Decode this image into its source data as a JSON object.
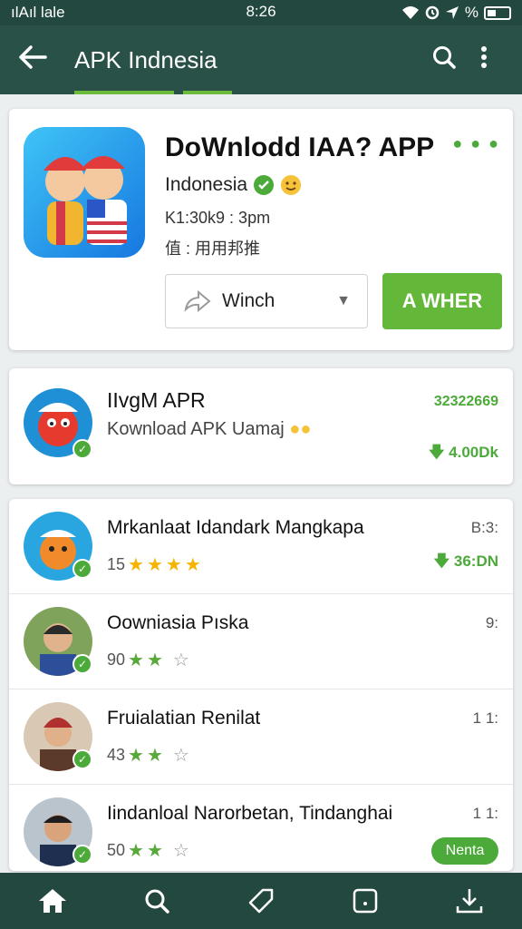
{
  "status_bar": {
    "carrier": "ılAıl lale",
    "time": "8:26",
    "battery": "%"
  },
  "app_bar": {
    "title": "APK Indnesia"
  },
  "hero": {
    "title": "DoWnlodd IAA? APP",
    "subtitle": "Indonesia",
    "meta": "K1:30k9 : 3pm",
    "meta2": "值 : 用用邦推",
    "secondary_button": "Winch",
    "primary_button": "A WHER"
  },
  "featured": {
    "title": "IIvgM APR",
    "subtitle": "Kownload APK Uamaj",
    "count": "32322669",
    "downloads": "4.00Dk"
  },
  "list": [
    {
      "title": "Mrkanlaat Idandark Mangkapa",
      "rating": "15",
      "stars": 4,
      "right": "B:3:",
      "right2": "36:DN"
    },
    {
      "title": "Oowniasia Pıska",
      "rating": "90",
      "stars": 2,
      "right": "9:"
    },
    {
      "title": "Fruialatian Renilat",
      "rating": "43",
      "stars": 2,
      "right": "1 1:"
    },
    {
      "title": "Iindanloal Narorbetan, Tindanghai",
      "rating": "50",
      "stars": 2,
      "right": "1 1:",
      "pill": "Nenta"
    }
  ],
  "colors": {
    "app_bar": "#2a5148",
    "accent": "#63b83a",
    "bottom_nav": "#23483f"
  }
}
